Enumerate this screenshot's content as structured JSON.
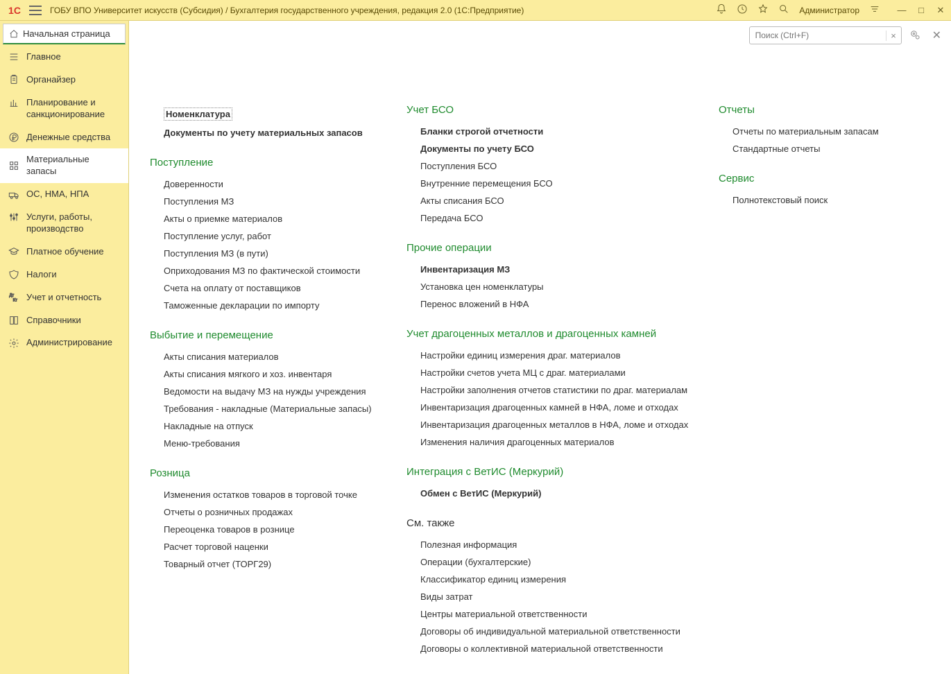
{
  "title": "ГОБУ ВПО Университет искусств (Субсидия) / Бухгалтерия государственного учреждения, редакция 2.0  (1С:Предприятие)",
  "user": "Администратор",
  "start_tab": "Начальная страница",
  "search_placeholder": "Поиск (Ctrl+F)",
  "search_clear": "×",
  "nav": [
    {
      "label": "Главное",
      "icon": "menu"
    },
    {
      "label": "Органайзер",
      "icon": "clipboard"
    },
    {
      "label": "Планирование и санкционирование",
      "icon": "chart"
    },
    {
      "label": "Денежные средства",
      "icon": "ruble"
    },
    {
      "label": "Материальные запасы",
      "icon": "grid",
      "active": true
    },
    {
      "label": "ОС, НМА, НПА",
      "icon": "truck"
    },
    {
      "label": "Услуги, работы, производство",
      "icon": "sliders"
    },
    {
      "label": "Платное обучение",
      "icon": "grad"
    },
    {
      "label": "Налоги",
      "icon": "eagle"
    },
    {
      "label": "Учет и отчетность",
      "icon": "dk"
    },
    {
      "label": "Справочники",
      "icon": "book"
    },
    {
      "label": "Администрирование",
      "icon": "gear"
    }
  ],
  "col1": {
    "top": [
      {
        "label": "Номенклатура",
        "boxed": true,
        "bold": true
      },
      {
        "label": "Документы по учету материальных запасов",
        "bold": true
      }
    ],
    "sections": [
      {
        "head": "Поступление",
        "items": [
          "Доверенности",
          "Поступления МЗ",
          "Акты о приемке материалов",
          "Поступление услуг, работ",
          "Поступления МЗ (в пути)",
          "Оприходования МЗ по фактической стоимости",
          "Счета на оплату от поставщиков",
          "Таможенные декларации по импорту"
        ]
      },
      {
        "head": "Выбытие и перемещение",
        "items": [
          "Акты списания материалов",
          "Акты списания мягкого и хоз. инвентаря",
          "Ведомости на выдачу МЗ на нужды учреждения",
          "Требования - накладные (Материальные запасы)",
          "Накладные на отпуск",
          "Меню-требования"
        ]
      },
      {
        "head": "Розница",
        "items": [
          "Изменения остатков товаров в торговой точке",
          "Отчеты о розничных продажах",
          "Переоценка товаров в рознице",
          "Расчет торговой наценки",
          "Товарный отчет (ТОРГ29)"
        ]
      }
    ]
  },
  "col2": {
    "sections": [
      {
        "head": "Учет БСО",
        "items": [
          {
            "label": "Бланки строгой отчетности",
            "bold": true
          },
          {
            "label": "Документы по учету БСО",
            "bold": true
          },
          {
            "label": "Поступления БСО"
          },
          {
            "label": "Внутренние перемещения БСО"
          },
          {
            "label": "Акты списания БСО"
          },
          {
            "label": "Передача БСО"
          }
        ]
      },
      {
        "head": "Прочие операции",
        "items": [
          {
            "label": "Инвентаризация МЗ",
            "bold": true
          },
          {
            "label": "Установка цен номенклатуры"
          },
          {
            "label": "Перенос вложений в НФА"
          }
        ]
      },
      {
        "head": "Учет драгоценных металлов и драгоценных камней",
        "items": [
          {
            "label": "Настройки единиц измерения драг. материалов"
          },
          {
            "label": "Настройки счетов учета МЦ с драг. материалами"
          },
          {
            "label": "Настройки заполнения отчетов статистики по драг. материалам"
          },
          {
            "label": "Инвентаризация драгоценных камней в НФА, ломе и отходах"
          },
          {
            "label": "Инвентаризация драгоценных металлов в НФА, ломе и отходах"
          },
          {
            "label": "Изменения наличия драгоценных материалов"
          }
        ]
      },
      {
        "head": "Интеграция с ВетИС (Меркурий)",
        "items": [
          {
            "label": "Обмен с ВетИС (Меркурий)",
            "bold": true
          }
        ]
      },
      {
        "head": "См. также",
        "plain": true,
        "items": [
          {
            "label": "Полезная информация"
          },
          {
            "label": "Операции (бухгалтерские)"
          },
          {
            "label": "Классификатор единиц измерения"
          },
          {
            "label": "Виды затрат"
          },
          {
            "label": "Центры материальной ответственности"
          },
          {
            "label": "Договоры об индивидуальной материальной ответственности"
          },
          {
            "label": "Договоры о коллективной материальной ответственности"
          }
        ]
      }
    ]
  },
  "col3": {
    "sections": [
      {
        "head": "Отчеты",
        "items": [
          {
            "label": "Отчеты по материальным запасам"
          },
          {
            "label": "Стандартные отчеты"
          }
        ]
      },
      {
        "head": "Сервис",
        "items": [
          {
            "label": "Полнотекстовый поиск"
          }
        ]
      }
    ]
  }
}
